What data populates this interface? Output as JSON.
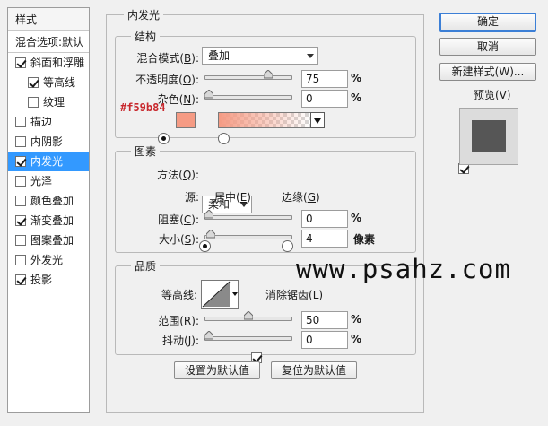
{
  "styles_panel": {
    "title": "样式",
    "blend_options": "混合选项:默认",
    "items": [
      {
        "label": "斜面和浮雕",
        "checked": true,
        "indent": false,
        "active": false
      },
      {
        "label": "等高线",
        "checked": true,
        "indent": true,
        "active": false
      },
      {
        "label": "纹理",
        "checked": false,
        "indent": true,
        "active": false
      },
      {
        "label": "描边",
        "checked": false,
        "indent": false,
        "active": false
      },
      {
        "label": "内阴影",
        "checked": false,
        "indent": false,
        "active": false
      },
      {
        "label": "内发光",
        "checked": true,
        "indent": false,
        "active": true
      },
      {
        "label": "光泽",
        "checked": false,
        "indent": false,
        "active": false
      },
      {
        "label": "颜色叠加",
        "checked": false,
        "indent": false,
        "active": false
      },
      {
        "label": "渐变叠加",
        "checked": true,
        "indent": false,
        "active": false
      },
      {
        "label": "图案叠加",
        "checked": false,
        "indent": false,
        "active": false
      },
      {
        "label": "外发光",
        "checked": false,
        "indent": false,
        "active": false
      },
      {
        "label": "投影",
        "checked": true,
        "indent": false,
        "active": false
      }
    ]
  },
  "panel_title": "内发光",
  "structure": {
    "title": "结构",
    "blend_mode": {
      "label": "混合模式",
      "key": "B",
      "value": "叠加"
    },
    "opacity": {
      "label": "不透明度",
      "key": "O",
      "value": "75",
      "unit": "%",
      "fraction": 0.75
    },
    "noise": {
      "label": "杂色",
      "key": "N",
      "value": "0",
      "unit": "%",
      "fraction": 0
    },
    "color_hex": "#f59b84",
    "color_swatch": "#f59b84",
    "color_mode_selected": "solid"
  },
  "elements": {
    "title": "图素",
    "method": {
      "label": "方法",
      "key": "Q",
      "value": "柔和"
    },
    "source": {
      "label": "源",
      "center": "居中",
      "center_key": "E",
      "edge": "边缘",
      "edge_key": "G",
      "selected": "center"
    },
    "choke": {
      "label": "阻塞",
      "key": "C",
      "value": "0",
      "unit": "%",
      "fraction": 0
    },
    "size": {
      "label": "大小",
      "key": "S",
      "value": "4",
      "unit": "像素",
      "fraction": 0.02
    }
  },
  "quality": {
    "title": "品质",
    "contour": {
      "label": "等高线"
    },
    "anti_alias": {
      "label": "消除锯齿",
      "key": "L",
      "checked": true
    },
    "range": {
      "label": "范围",
      "key": "R",
      "value": "50",
      "unit": "%",
      "fraction": 0.5
    },
    "jitter": {
      "label": "抖动",
      "key": "J",
      "value": "0",
      "unit": "%",
      "fraction": 0
    }
  },
  "footer": {
    "set_default": "设置为默认值",
    "reset_default": "复位为默认值"
  },
  "right_panel": {
    "ok": "确定",
    "cancel": "取消",
    "new_style": "新建样式(W)...",
    "preview": {
      "label": "预览(V)",
      "checked": true
    }
  },
  "watermark": "www.psahz.com"
}
